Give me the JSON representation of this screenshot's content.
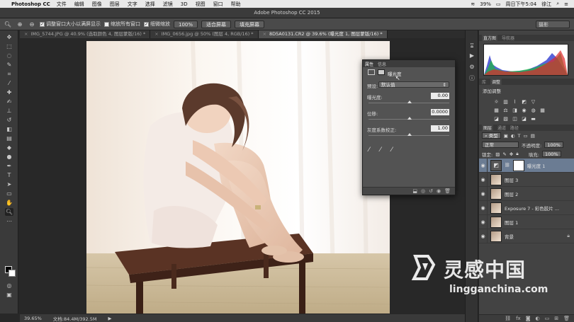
{
  "menubar": {
    "app": "Photoshop CC",
    "items": [
      "文件",
      "编辑",
      "图像",
      "图层",
      "文字",
      "选择",
      "滤镜",
      "3D",
      "视图",
      "窗口",
      "帮助"
    ],
    "battery": "39%",
    "datetime": "周日下午5:04",
    "user": "徐江"
  },
  "window": {
    "title": "Adobe Photoshop CC 2015"
  },
  "options": {
    "check1": "调整窗口大小以满屏显示",
    "check2": "缩放所有窗口",
    "check3": "细微缩放",
    "zoom_btn": "100%",
    "fit_btn": "适合屏幕",
    "fill_btn": "填充屏幕",
    "workspace": "摄影"
  },
  "tabs": [
    {
      "label": "IMG_5744.JPG @ 40.9% (选取颜色 4, 图层蒙版/16) *"
    },
    {
      "label": "IMG_0656.jpg @ 50% (图层 4, RGB/16) *"
    },
    {
      "label": "8D5A0131.CR2 @ 39.6% (曝光度 1, 图层蒙版/16) *"
    }
  ],
  "status": {
    "zoom": "39.65%",
    "doc": "文档:84.4M/392.5M"
  },
  "properties": {
    "tab1": "属性",
    "tab2": "信息",
    "header": "曝光度",
    "preset_label": "预设:",
    "preset_value": "默认值",
    "exposure_label": "曝光度:",
    "exposure_value": "0.00",
    "offset_label": "位移:",
    "offset_value": "0.0000",
    "gamma_label": "灰度系数校正:",
    "gamma_value": "1.00"
  },
  "panels": {
    "histogram_tab": "直方图",
    "navigator_tab": "导航器",
    "library_tab": "库",
    "adjust_tab": "调整",
    "adjust_title": "添加调整",
    "layers_tab": "图层",
    "channels_tab": "通道",
    "paths_tab": "路径",
    "kind": "类型",
    "blend": "正常",
    "opacity_label": "不透明度:",
    "opacity_value": "100%",
    "lock_label": "锁定:",
    "fill_label": "填充:",
    "fill_value": "100%"
  },
  "layers": [
    {
      "name": "曝光度 1"
    },
    {
      "name": "图层 3"
    },
    {
      "name": "图层 2"
    },
    {
      "name": "Exposure 7 - 彩色胶片 ..."
    },
    {
      "name": "图层 1"
    },
    {
      "name": "背景"
    }
  ],
  "watermark": {
    "cn": "灵感中国",
    "en": "lingganchina.com"
  }
}
